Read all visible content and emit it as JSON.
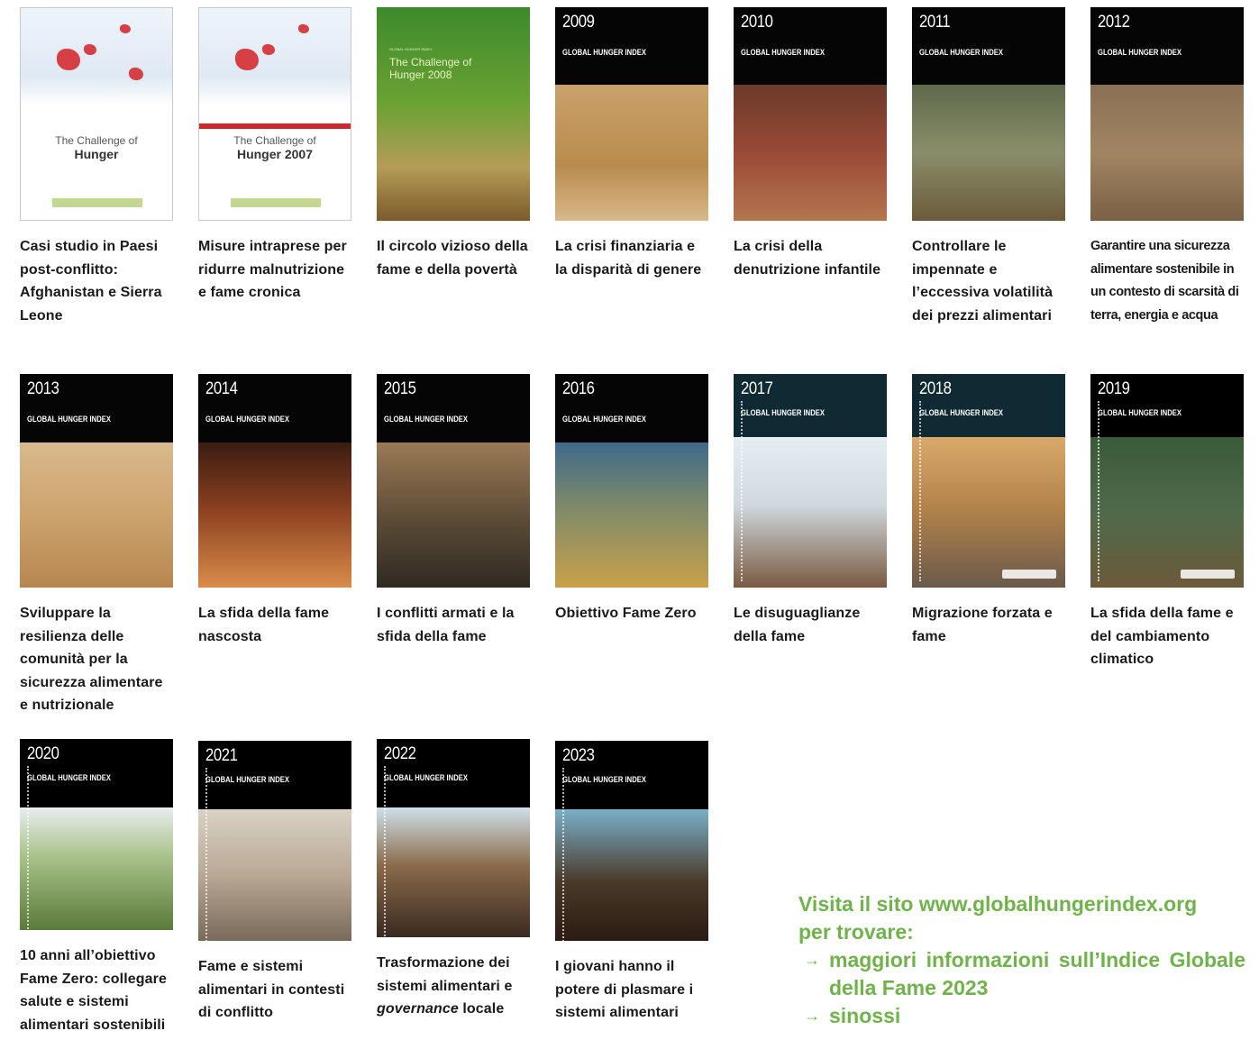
{
  "reports": [
    {
      "year": "",
      "cover_title": "The Challenge of",
      "cover_title2": "Hunger",
      "caption": "Casi studio in Paesi post-conflitto: Afghanistan e Sierra Leone"
    },
    {
      "year": "",
      "cover_title": "The Challenge of",
      "cover_title2": "Hunger 2007",
      "caption": "Misure intraprese per ridurre malnutrizione e fame cronica"
    },
    {
      "year": "",
      "cover_title": "The Challenge of",
      "cover_title2": "Hunger 2008",
      "caption": "Il circolo vizioso della fame e della povertà"
    },
    {
      "year": "2009",
      "cover_title": "GLOBAL HUNGER INDEX",
      "caption": "La crisi finanziaria e la disparità di genere"
    },
    {
      "year": "2010",
      "cover_title": "GLOBAL HUNGER INDEX",
      "caption": "La crisi della denutrizione infantile"
    },
    {
      "year": "2011",
      "cover_title": "GLOBAL HUNGER INDEX",
      "caption": "Controllare le impennate e l’eccessiva volatilità dei prezzi alimentari"
    },
    {
      "year": "2012",
      "cover_title": "GLOBAL HUNGER INDEX",
      "caption": "Garantire una sicurezza alimentare sostenibile in un contesto di scarsità di terra, energia e acqua"
    },
    {
      "year": "2013",
      "cover_title": "GLOBAL HUNGER INDEX",
      "caption": "Sviluppare la resilienza delle comunità per la sicurezza alimentare e nutrizionale"
    },
    {
      "year": "2014",
      "cover_title": "GLOBAL HUNGER INDEX",
      "caption": "La sfida della fame nascosta"
    },
    {
      "year": "2015",
      "cover_title": "GLOBAL HUNGER INDEX",
      "caption": "I conflitti armati e la sfida della fame"
    },
    {
      "year": "2016",
      "cover_title": "GLOBAL HUNGER INDEX",
      "caption": "Obiettivo Fame Zero"
    },
    {
      "year": "2017",
      "cover_title": "GLOBAL HUNGER INDEX",
      "caption": "Le disuguaglianze della fame"
    },
    {
      "year": "2018",
      "cover_title": "GLOBAL HUNGER INDEX",
      "caption": "Migrazione forzata e fame"
    },
    {
      "year": "2019",
      "cover_title": "GLOBAL HUNGER INDEX",
      "caption": "La sfida della fame e del cambiamento climatico"
    },
    {
      "year": "2020",
      "cover_title": "GLOBAL HUNGER INDEX",
      "caption": "10 anni all’obiettivo Fame Zero: collegare salute e sistemi alimentari sostenibili"
    },
    {
      "year": "2021",
      "cover_title": "GLOBAL HUNGER INDEX",
      "caption": "Fame e sistemi alimentari in contesti di conflitto"
    },
    {
      "year": "2022",
      "cover_title": "GLOBAL HUNGER INDEX",
      "caption_pre": "Trasformazione dei sistemi alimentari e ",
      "caption_em": "governance",
      "caption_post": " locale"
    },
    {
      "year": "2023",
      "cover_title": "GLOBAL HUNGER INDEX",
      "caption": "I giovani hanno il potere di plasmare i sistemi alimentari"
    }
  ],
  "visit": {
    "line1": "Visita il sito www.globalhungerindex.org",
    "line2": "per trovare:",
    "bullet_symbol": "→",
    "bullets": [
      "maggiori informazioni sull’Indice Globale della Fame 2023",
      "sinossi"
    ]
  },
  "colors": {
    "accent": "#6fb34a",
    "text": "#1a1a1a"
  }
}
